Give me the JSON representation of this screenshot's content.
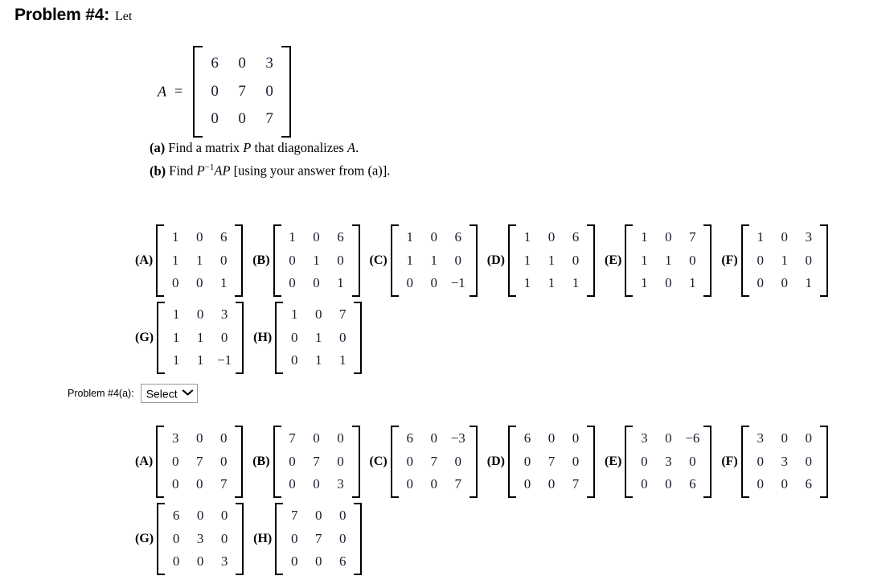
{
  "header": {
    "problem_label": "Problem #4:",
    "lead_text": "Let"
  },
  "matrix_A": {
    "variable": "A",
    "equals": "=",
    "rows": [
      [
        "6",
        "0",
        "3"
      ],
      [
        "0",
        "7",
        "0"
      ],
      [
        "0",
        "0",
        "7"
      ]
    ]
  },
  "subquestions": [
    {
      "label": "(a)",
      "text_before": "Find a matrix ",
      "var1": "P",
      "text_mid": " that diagonalizes ",
      "var2": "A",
      "text_after": "."
    },
    {
      "label": "(b)",
      "text_before": "Find ",
      "var1": "P",
      "sup": "−1",
      "var2": "AP",
      "text_after": " [using your answer from (a)]."
    }
  ],
  "answer_select": {
    "label": "Problem #4(a):",
    "value": "Select",
    "chevron": "chevron-down"
  },
  "options_a": [
    {
      "label": "(A)",
      "rows": [
        [
          "1",
          "0",
          "6"
        ],
        [
          "1",
          "1",
          "0"
        ],
        [
          "0",
          "0",
          "1"
        ]
      ]
    },
    {
      "label": "(B)",
      "rows": [
        [
          "1",
          "0",
          "6"
        ],
        [
          "0",
          "1",
          "0"
        ],
        [
          "0",
          "0",
          "1"
        ]
      ]
    },
    {
      "label": "(C)",
      "rows": [
        [
          "1",
          "0",
          "6"
        ],
        [
          "1",
          "1",
          "0"
        ],
        [
          "0",
          "0",
          "−1"
        ]
      ]
    },
    {
      "label": "(D)",
      "rows": [
        [
          "1",
          "0",
          "6"
        ],
        [
          "1",
          "1",
          "0"
        ],
        [
          "1",
          "1",
          "1"
        ]
      ]
    },
    {
      "label": "(E)",
      "rows": [
        [
          "1",
          "0",
          "7"
        ],
        [
          "1",
          "1",
          "0"
        ],
        [
          "1",
          "0",
          "1"
        ]
      ]
    },
    {
      "label": "(F)",
      "rows": [
        [
          "1",
          "0",
          "3"
        ],
        [
          "0",
          "1",
          "0"
        ],
        [
          "0",
          "0",
          "1"
        ]
      ]
    },
    {
      "label": "(G)",
      "rows": [
        [
          "1",
          "0",
          "3"
        ],
        [
          "1",
          "1",
          "0"
        ],
        [
          "1",
          "1",
          "−1"
        ]
      ]
    },
    {
      "label": "(H)",
      "rows": [
        [
          "1",
          "0",
          "7"
        ],
        [
          "0",
          "1",
          "0"
        ],
        [
          "0",
          "1",
          "1"
        ]
      ]
    }
  ],
  "options_b": [
    {
      "label": "(A)",
      "rows": [
        [
          "3",
          "0",
          "0"
        ],
        [
          "0",
          "7",
          "0"
        ],
        [
          "0",
          "0",
          "7"
        ]
      ]
    },
    {
      "label": "(B)",
      "rows": [
        [
          "7",
          "0",
          "0"
        ],
        [
          "0",
          "7",
          "0"
        ],
        [
          "0",
          "0",
          "3"
        ]
      ]
    },
    {
      "label": "(C)",
      "rows": [
        [
          "6",
          "0",
          "−3"
        ],
        [
          "0",
          "7",
          "0"
        ],
        [
          "0",
          "0",
          "7"
        ]
      ]
    },
    {
      "label": "(D)",
      "rows": [
        [
          "6",
          "0",
          "0"
        ],
        [
          "0",
          "7",
          "0"
        ],
        [
          "0",
          "0",
          "7"
        ]
      ]
    },
    {
      "label": "(E)",
      "rows": [
        [
          "3",
          "0",
          "−6"
        ],
        [
          "0",
          "3",
          "0"
        ],
        [
          "0",
          "0",
          "6"
        ]
      ]
    },
    {
      "label": "(F)",
      "rows": [
        [
          "3",
          "0",
          "0"
        ],
        [
          "0",
          "3",
          "0"
        ],
        [
          "0",
          "0",
          "6"
        ]
      ]
    },
    {
      "label": "(G)",
      "rows": [
        [
          "6",
          "0",
          "0"
        ],
        [
          "0",
          "3",
          "0"
        ],
        [
          "0",
          "0",
          "3"
        ]
      ]
    },
    {
      "label": "(H)",
      "rows": [
        [
          "7",
          "0",
          "0"
        ],
        [
          "0",
          "7",
          "0"
        ],
        [
          "0",
          "0",
          "6"
        ]
      ]
    }
  ],
  "colors": {
    "text": "#000000",
    "matrix_entry": "#1a1a2e",
    "select_border": "#9a9a9a",
    "background": "#ffffff"
  }
}
